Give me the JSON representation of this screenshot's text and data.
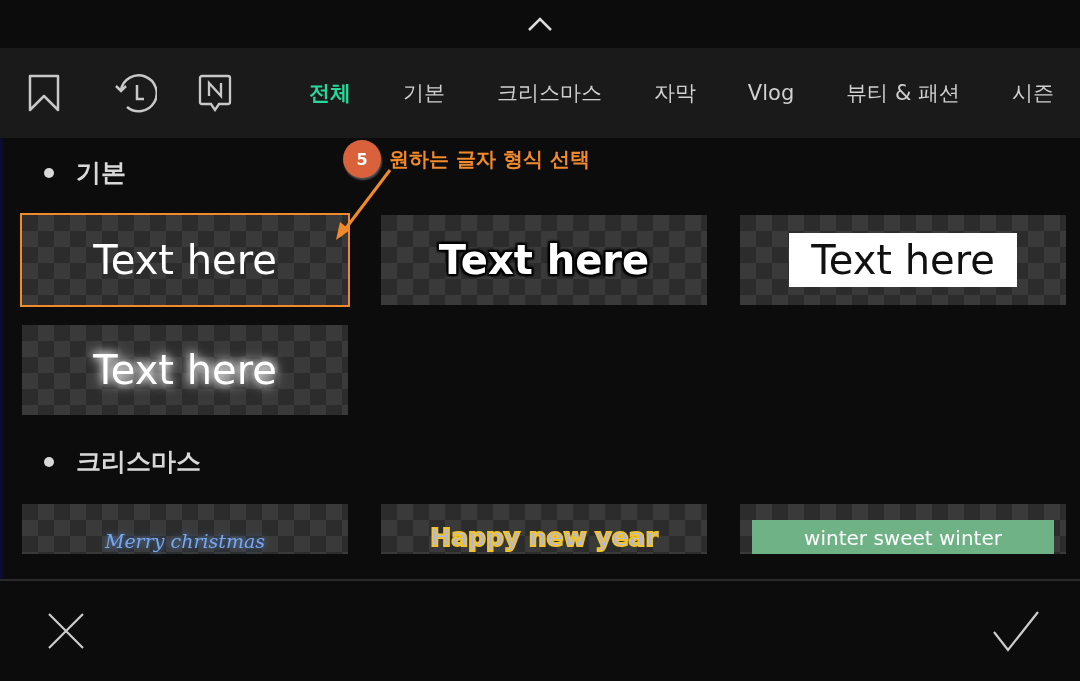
{
  "icon_tabs": [
    {
      "kind": "bookmark",
      "selected": false
    },
    {
      "kind": "recent",
      "selected": false
    },
    {
      "kind": "new",
      "selected": false
    }
  ],
  "tabs": [
    {
      "label": "전체",
      "selected": true
    },
    {
      "label": "기본",
      "selected": false
    },
    {
      "label": "크리스마스",
      "selected": false
    },
    {
      "label": "자막",
      "selected": false
    },
    {
      "label": "Vlog",
      "selected": false
    },
    {
      "label": "뷰티 & 패션",
      "selected": false
    },
    {
      "label": "시즌",
      "selected": false
    }
  ],
  "callout": {
    "number": "5",
    "text": "원하는 글자 형식 선택"
  },
  "sections": [
    {
      "title": "기본",
      "styles": [
        {
          "kind": "plain",
          "text": "Text here",
          "selected": true
        },
        {
          "kind": "outline",
          "text": "Text here",
          "selected": false
        },
        {
          "kind": "boxed",
          "text": "Text here",
          "selected": false
        },
        {
          "kind": "glow",
          "text": "Text here",
          "selected": false
        }
      ]
    },
    {
      "title": "크리스마스",
      "styles": [
        {
          "kind": "script",
          "text": "Merry christmas",
          "selected": false
        },
        {
          "kind": "bubbly",
          "text": "Happy new year",
          "selected": false
        },
        {
          "kind": "banner",
          "text": "winter sweet winter",
          "selected": false
        }
      ]
    }
  ]
}
